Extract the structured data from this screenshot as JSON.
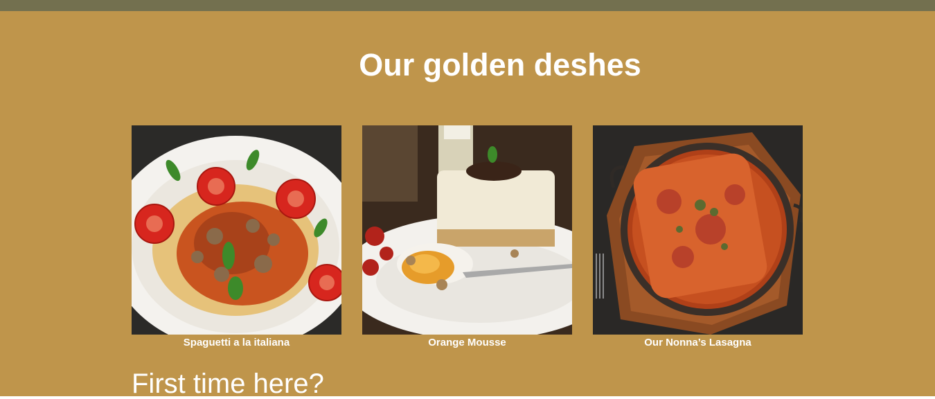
{
  "section": {
    "title": "Our golden deshes",
    "background": "#bf954b",
    "top_bar_color": "#73704f"
  },
  "dishes": [
    {
      "name": "Spaguetti a la italiana",
      "image": "spaghetti-photo"
    },
    {
      "name": "Orange Mousse",
      "image": "mousse-photo"
    },
    {
      "name": "Our Nonna’s Lasagna",
      "image": "lasagna-photo"
    }
  ],
  "next_section": {
    "heading": "First time here?"
  }
}
